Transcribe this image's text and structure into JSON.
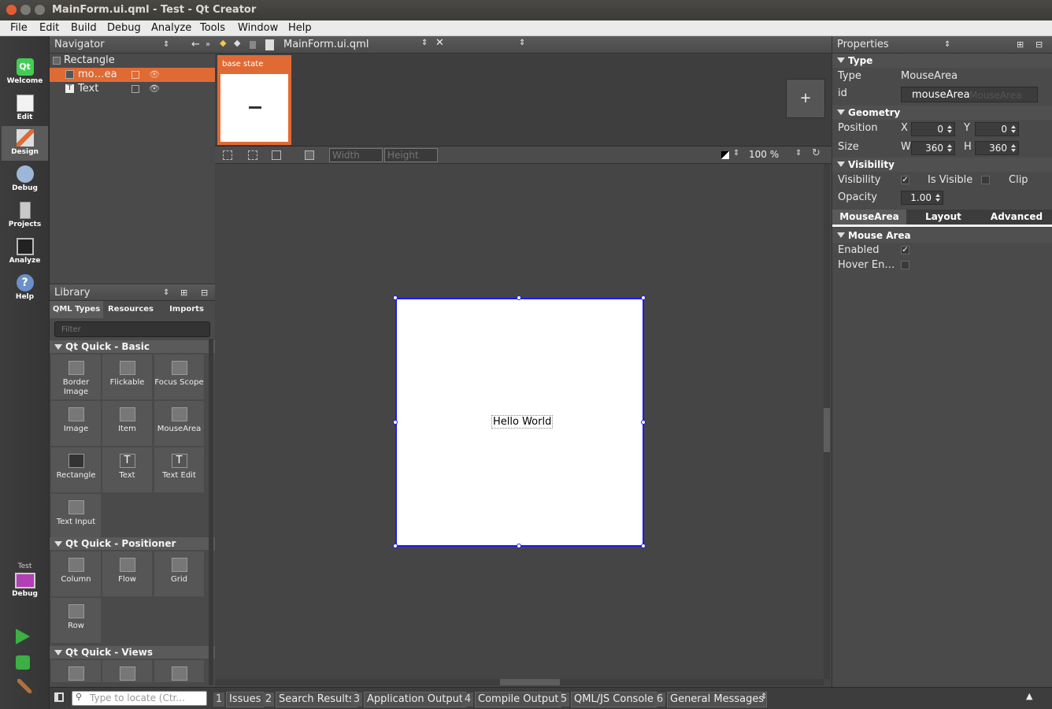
{
  "window": {
    "title": "MainForm.ui.qml - Test - Qt Creator"
  },
  "menu": [
    "File",
    "Edit",
    "Build",
    "Debug",
    "Analyze",
    "Tools",
    "Window",
    "Help"
  ],
  "modes": [
    {
      "label": "Welcome",
      "icon": "qt-logo-icon"
    },
    {
      "label": "Edit",
      "icon": "edit-document-icon"
    },
    {
      "label": "Design",
      "icon": "design-brush-icon"
    },
    {
      "label": "Debug",
      "icon": "debug-bug-icon"
    },
    {
      "label": "Projects",
      "icon": "projects-icon"
    },
    {
      "label": "Analyze",
      "icon": "analyze-monitor-icon"
    },
    {
      "label": "Help",
      "icon": "help-icon"
    }
  ],
  "kit": {
    "project": "Test",
    "config": "Debug"
  },
  "navigator": {
    "title": "Navigator",
    "items": [
      {
        "label": "Rectangle"
      },
      {
        "label": "mo…ea"
      },
      {
        "label": "Text"
      }
    ]
  },
  "library": {
    "title": "Library",
    "tabs": [
      "QML Types",
      "Resources",
      "Imports"
    ],
    "filter_placeholder": "Filter",
    "categories": [
      {
        "name": "Qt Quick - Basic",
        "items": [
          "Border Image",
          "Flickable",
          "Focus Scope",
          "Image",
          "Item",
          "MouseArea",
          "Rectangle",
          "Text",
          "Text Edit",
          "Text Input"
        ]
      },
      {
        "name": "Qt Quick - Positioner",
        "items": [
          "Column",
          "Flow",
          "Grid",
          "Row"
        ]
      },
      {
        "name": "Qt Quick - Views",
        "items": []
      }
    ]
  },
  "editor": {
    "file_name": "MainForm.ui.qml",
    "state_label": "base state",
    "add_state": "+",
    "width_placeholder": "Width",
    "height_placeholder": "Height",
    "zoom": "100 %",
    "canvas_text": "Hello World"
  },
  "properties": {
    "title": "Properties",
    "type_section": "Type",
    "type_label": "Type",
    "type_value": "MouseArea",
    "id_label": "id",
    "id_value": "mouseArea",
    "id_ghost": "MouseArea",
    "geometry_section": "Geometry",
    "position_label": "Position",
    "x_label": "X",
    "x_value": "0",
    "y_label": "Y",
    "y_value": "0",
    "size_label": "Size",
    "w_label": "W",
    "w_value": "360",
    "h_label": "H",
    "h_value": "360",
    "visibility_section": "Visibility",
    "visibility_label": "Visibility",
    "is_visible_label": "Is Visible",
    "clip_label": "Clip",
    "opacity_label": "Opacity",
    "opacity_value": "1.00",
    "tabs": [
      "MouseArea",
      "Layout",
      "Advanced"
    ],
    "mousearea_section": "Mouse Area",
    "enabled_label": "Enabled",
    "hover_label": "Hover En…"
  },
  "status": {
    "locate_placeholder": "Type to locate (Ctr...",
    "tabs": [
      {
        "n": "1",
        "label": "Issues"
      },
      {
        "n": "2",
        "label": "Search Results"
      },
      {
        "n": "3",
        "label": "Application Output"
      },
      {
        "n": "4",
        "label": "Compile Output"
      },
      {
        "n": "5",
        "label": "QML/JS Console"
      },
      {
        "n": "6",
        "label": "General Messages"
      }
    ]
  },
  "colors": {
    "accent": "#e06a34",
    "selection": "#1a1aff",
    "background": "#454545"
  }
}
